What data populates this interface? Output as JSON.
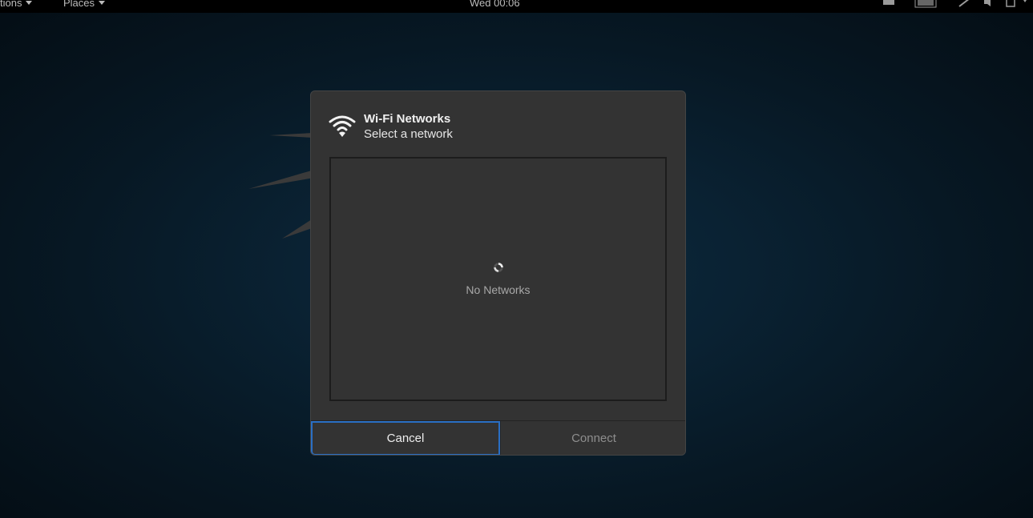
{
  "topbar": {
    "activities_label": "tions",
    "places_label": "Places",
    "clock": "Wed 00:06"
  },
  "dialog": {
    "title": "Wi-Fi Networks",
    "subtitle": "Select a network",
    "icon": "wifi-icon",
    "network_list": {
      "empty_text": "No Networks",
      "loading": true
    },
    "buttons": {
      "cancel_label": "Cancel",
      "connect_label": "Connect"
    }
  },
  "colors": {
    "accent_focus": "#2a6fc4",
    "dialog_bg": "#333333",
    "desktop_bg": "#0a2233"
  }
}
